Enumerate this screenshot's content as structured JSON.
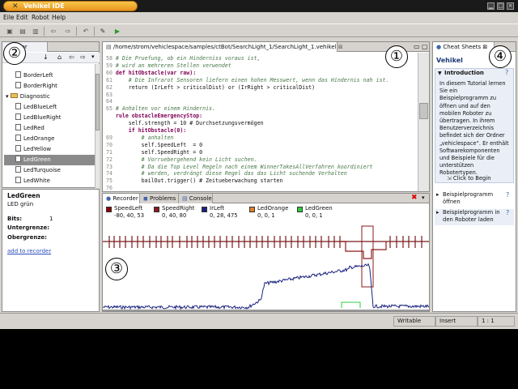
{
  "window": {
    "title": "Vehikel IDE"
  },
  "menu": [
    "Eile",
    "Edit",
    "Robot",
    "Help"
  ],
  "toolbar": [
    "save-icon",
    "open-icon",
    "new-icon",
    "back-icon",
    "forward-icon",
    "undo-icon",
    "tool-icon",
    "run-icon"
  ],
  "left_panel": {
    "tab": "Actor",
    "items": [
      {
        "label": "BorderLeft",
        "kind": "leaf"
      },
      {
        "label": "BorderRight",
        "kind": "leaf"
      },
      {
        "label": "Diagnostic",
        "kind": "folder"
      },
      {
        "label": "LedBlueLeft",
        "kind": "leaf"
      },
      {
        "label": "LedBlueRight",
        "kind": "leaf"
      },
      {
        "label": "LedRed",
        "kind": "leaf"
      },
      {
        "label": "LedOrange",
        "kind": "leaf"
      },
      {
        "label": "LedYellow",
        "kind": "leaf"
      },
      {
        "label": "LedGreen",
        "kind": "leaf",
        "selected": true
      },
      {
        "label": "LedTurquoise",
        "kind": "leaf"
      },
      {
        "label": "LedWhite",
        "kind": "leaf"
      }
    ],
    "details": {
      "name": "LedGreen",
      "desc": "LED grün",
      "bits_label": "Bits:",
      "bits_value": "1",
      "lower_label": "Untergrenze:",
      "upper_label": "Obergrenze:",
      "link": "add to recorder"
    }
  },
  "editor": {
    "tab": "/home/strom/vehiclespace/samples/ctBot/SearchLight_1/SearchLight_1.vehikel",
    "lines": [
      {
        "n": "58",
        "t": "# Die Pruefung, ob ein Hinderniss voraus ist,",
        "c": "cm"
      },
      {
        "n": "59",
        "t": "# wird an mehreren Stellen verwendet",
        "c": "cm"
      },
      {
        "n": "60",
        "t": "def hitObstacle(var raw):",
        "c": "kw"
      },
      {
        "n": "61",
        "t": "    # Die Infrarot Sensoren liefern einen hohen Messwert, wenn das Hindernis nah ist.",
        "c": "cm"
      },
      {
        "n": "62",
        "t": "    return (IrLeft > criticalDist) or (IrRight > criticalDist)",
        "c": "code"
      },
      {
        "n": "63",
        "t": "",
        "c": "code"
      },
      {
        "n": "64",
        "t": "",
        "c": "code"
      },
      {
        "n": "65",
        "t": "# Anhalten vor einem Hindernis.",
        "c": "cm"
      },
      {
        "n": "",
        "t": "rule obstacleEmergencyStop:",
        "c": "kw"
      },
      {
        "n": "",
        "t": "    self.strength = 10 # Durchsetzungsvermögen",
        "c": "code"
      },
      {
        "n": "",
        "t": "    if hitObstacle(0):",
        "c": "kw"
      },
      {
        "n": "69",
        "t": "        # anhalten",
        "c": "cm"
      },
      {
        "n": "70",
        "t": "        self.SpeedLeft  = 0",
        "c": "code"
      },
      {
        "n": "71",
        "t": "        self.SpeedRight = 0",
        "c": "code"
      },
      {
        "n": "72",
        "t": "        # Vorruebergehend kein Licht suchen.",
        "c": "cm"
      },
      {
        "n": "73",
        "t": "        # Da die Top Level Regeln nach einem WinnerTakesAllVerfahren koordiniert",
        "c": "cm"
      },
      {
        "n": "74",
        "t": "        # werden, verdrängt diese Regel das das Licht suchende Verhalten",
        "c": "cm"
      },
      {
        "n": "75",
        "t": "        bailOut.trigger() # Zeitueberwachung starten",
        "c": "code"
      },
      {
        "n": "76",
        "t": "",
        "c": "code"
      }
    ]
  },
  "recorder": {
    "tabs": [
      "Recorder",
      "Problems",
      "Console"
    ],
    "legend": [
      {
        "name": "SpeedLeft",
        "values": "-80, 40, 53",
        "color": "#8b0000"
      },
      {
        "name": "SpeedRight",
        "values": "0, 40, 80",
        "color": "#8b1a1a"
      },
      {
        "name": "IrLeft",
        "values": "0, 28, 475",
        "color": "#1a237e"
      },
      {
        "name": "LedOrange",
        "values": "0, 0, 1",
        "color": "#e0812a"
      },
      {
        "name": "LedGreen",
        "values": "0, 0, 1",
        "color": "#2ecc40"
      }
    ]
  },
  "cheatsheet": {
    "tab": "Cheat Sheets",
    "title": "Vehikel",
    "intro_title": "Introduction",
    "intro_text": [
      "In diesem Tutorial lernen",
      "Sie ein",
      "Beispielprogramm zu",
      "öffnen und auf den",
      "mobilen Roboter zu",
      "übertragen. In ihrem",
      "Benutzerverzeichnis",
      "befindet sich der Ordner",
      "„vehiclespace“. Er enthält",
      "Softwarekomponenten",
      "und Beispiele für die",
      "unterstützen",
      "Robotertypen."
    ],
    "begin": "Click to Begin",
    "steps": [
      [
        "Beispielprogramm",
        "öffnen"
      ],
      [
        "Beispielprogramm in",
        "den Roboter laden"
      ]
    ]
  },
  "status": {
    "mode": "Writable",
    "insert": "Insert",
    "pos": "1 : 1"
  },
  "callouts": [
    "①",
    "②",
    "③",
    "④"
  ]
}
